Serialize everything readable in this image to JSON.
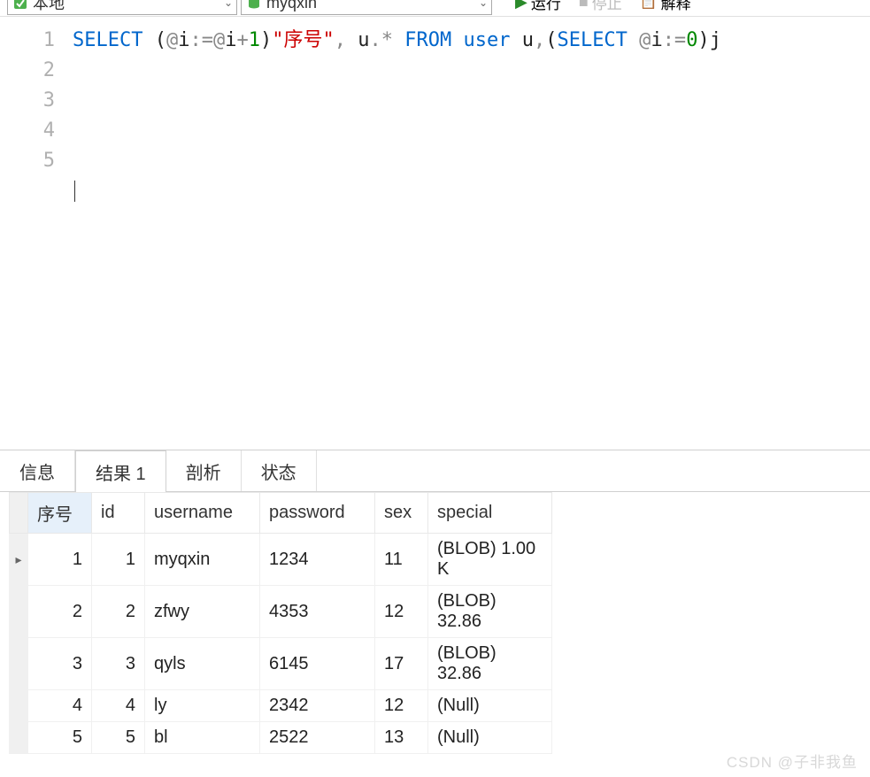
{
  "toolbar": {
    "connection": {
      "label": "本地"
    },
    "database": {
      "label": "myqxin"
    },
    "run": "运行",
    "stop": "停止",
    "explain": "解释"
  },
  "editor": {
    "line_numbers": [
      "1",
      "2",
      "3",
      "4",
      "5"
    ],
    "sql": {
      "kw_select1": "SELECT",
      "paren1": " (",
      "op_at1": "@",
      "txt_i1": "i",
      "op_assign1": ":=",
      "op_at2": "@",
      "txt_i2": "i",
      "op_plus": "+",
      "num1": "1",
      "paren2": ")",
      "str1": "\"序号\"",
      "txt_comma": ",",
      "txt_u": " u",
      "op_dot": ".",
      "op_star": "*",
      "kw_from": " FROM",
      "kw_user": " user",
      "txt_u2": " u",
      "txt_comma2": ",",
      "paren3": "(",
      "kw_select2": "SELECT",
      "op_at3": " @",
      "txt_i3": "i",
      "op_assign2": ":=",
      "num0": "0",
      "paren4": ")",
      "txt_j": "j"
    }
  },
  "tabs": {
    "info": "信息",
    "result": "结果 1",
    "profile": "剖析",
    "status": "状态"
  },
  "result": {
    "headers": {
      "rownum": "序号",
      "id": "id",
      "username": "username",
      "password": "password",
      "sex": "sex",
      "special": "special"
    },
    "rows": [
      {
        "mark": "▸",
        "rownum": "1",
        "id": "1",
        "username": "myqxin",
        "password": "1234",
        "sex": "11",
        "special": "(BLOB) 1.00 K"
      },
      {
        "mark": "",
        "rownum": "2",
        "id": "2",
        "username": "zfwy",
        "password": "4353",
        "sex": "12",
        "special": "(BLOB) 32.86"
      },
      {
        "mark": "",
        "rownum": "3",
        "id": "3",
        "username": "qyls",
        "password": "6145",
        "sex": "17",
        "special": "(BLOB) 32.86"
      },
      {
        "mark": "",
        "rownum": "4",
        "id": "4",
        "username": "ly",
        "password": "2342",
        "sex": "12",
        "special": "(Null)",
        "null": true
      },
      {
        "mark": "",
        "rownum": "5",
        "id": "5",
        "username": "bl",
        "password": "2522",
        "sex": "13",
        "special": "(Null)",
        "null": true
      }
    ]
  },
  "watermark": "CSDN @子非我鱼"
}
